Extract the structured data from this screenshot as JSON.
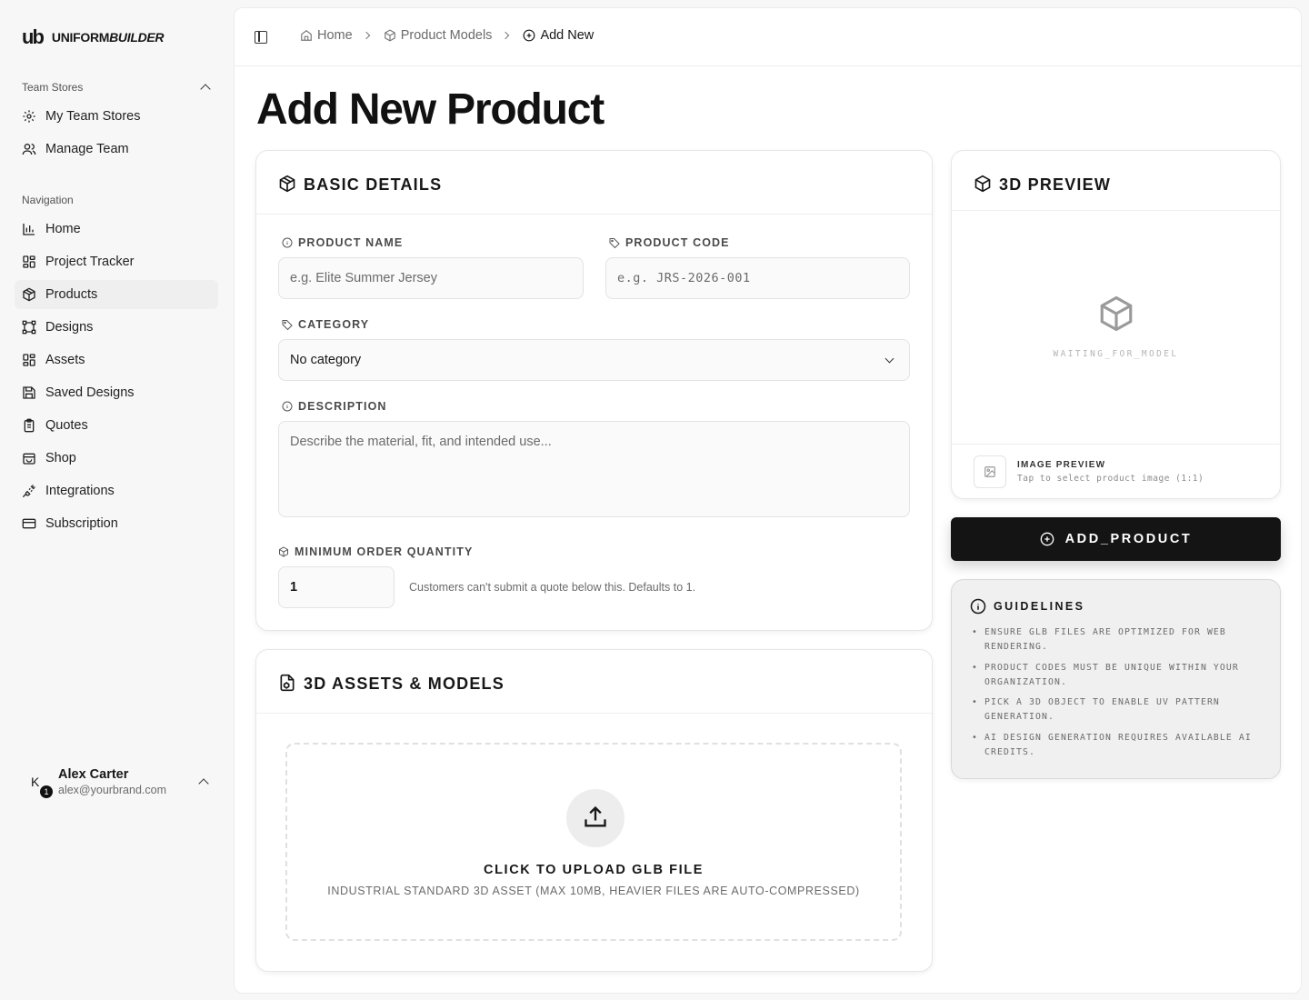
{
  "brand": {
    "mark": "ub",
    "name_plain": "UNIFORM",
    "name_bold": "BUILDER"
  },
  "sidebar": {
    "team_group_label": "Team Stores",
    "team_items": [
      {
        "label": "My Team Stores",
        "icon": "gear-icon"
      },
      {
        "label": "Manage Team",
        "icon": "users-icon"
      }
    ],
    "nav_group_label": "Navigation",
    "nav_items": [
      {
        "label": "Home",
        "icon": "bar-chart-icon"
      },
      {
        "label": "Project Tracker",
        "icon": "grid-icon"
      },
      {
        "label": "Products",
        "icon": "package-icon",
        "active": true
      },
      {
        "label": "Designs",
        "icon": "vector-icon"
      },
      {
        "label": "Assets",
        "icon": "grid-icon"
      },
      {
        "label": "Saved Designs",
        "icon": "save-icon"
      },
      {
        "label": "Quotes",
        "icon": "clipboard-icon"
      },
      {
        "label": "Shop",
        "icon": "shopping-bag-icon"
      },
      {
        "label": "Integrations",
        "icon": "plug-icon"
      },
      {
        "label": "Subscription",
        "icon": "credit-card-icon"
      }
    ],
    "user": {
      "initial": "K",
      "badge": "1",
      "name": "Alex Carter",
      "email": "alex@yourbrand.com"
    }
  },
  "breadcrumb": {
    "home": "Home",
    "models": "Product Models",
    "current": "Add New"
  },
  "page_title": "Add New Product",
  "basic_details": {
    "title": "BASIC DETAILS",
    "product_name_label": "PRODUCT NAME",
    "product_name_placeholder": "e.g. Elite Summer Jersey",
    "product_code_label": "PRODUCT CODE",
    "product_code_placeholder": "e.g. JRS-2026-001",
    "category_label": "CATEGORY",
    "category_value": "No category",
    "description_label": "DESCRIPTION",
    "description_placeholder": "Describe the material, fit, and intended use...",
    "moq_label": "MINIMUM ORDER QUANTITY",
    "moq_value": "1",
    "moq_hint": "Customers can't submit a quote below this. Defaults to 1."
  },
  "assets": {
    "title": "3D ASSETS & MODELS",
    "upload_title": "CLICK TO UPLOAD GLB FILE",
    "upload_sub": "INDUSTRIAL STANDARD 3D ASSET (MAX 10MB, HEAVIER FILES ARE AUTO-COMPRESSED)"
  },
  "preview": {
    "title": "3D PREVIEW",
    "waiting": "WAITING_FOR_MODEL",
    "image_title": "IMAGE PREVIEW",
    "image_sub": "Tap to select product image (1:1)"
  },
  "add_button": "ADD_PRODUCT",
  "guidelines": {
    "title": "GUIDELINES",
    "items": [
      "ENSURE GLB FILES ARE OPTIMIZED FOR WEB RENDERING.",
      "PRODUCT CODES MUST BE UNIQUE WITHIN YOUR ORGANIZATION.",
      "PICK A 3D OBJECT TO ENABLE UV PATTERN GENERATION.",
      "AI DESIGN GENERATION REQUIRES AVAILABLE AI CREDITS."
    ]
  }
}
